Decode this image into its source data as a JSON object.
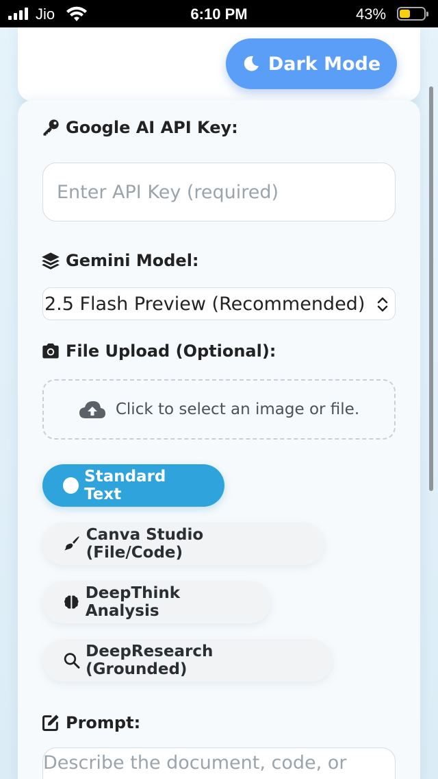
{
  "status_bar": {
    "carrier": "Jio",
    "time": "6:10 PM",
    "battery_percent": "43%",
    "battery_level": 0.43
  },
  "header": {
    "dark_mode_label": "Dark Mode"
  },
  "form": {
    "api_key_label": "Google AI API Key:",
    "api_key_placeholder": "Enter API Key (required)",
    "api_key_value": "",
    "model_label": "Gemini Model:",
    "model_selected": "2.5 Flash Preview (Recommended)",
    "upload_label": "File Upload (Optional):",
    "upload_hint": "Click to select an image or file.",
    "modes": [
      {
        "label": "Standard Text",
        "active": true
      },
      {
        "label": "Canva Studio (File/Code)",
        "active": false
      },
      {
        "label": "DeepThink Analysis",
        "active": false
      },
      {
        "label": "DeepResearch (Grounded)",
        "active": false
      }
    ],
    "prompt_label": "Prompt:",
    "prompt_placeholder": "Describe the document, code, or"
  },
  "icons": {
    "dark_mode": "moon-icon",
    "api_key": "key-icon",
    "model": "layers-icon",
    "upload": "camera-icon",
    "upload_zone": "cloud-upload-icon",
    "canva": "paintbrush-icon",
    "deepthink": "brain-icon",
    "deepresearch": "search-icon",
    "prompt": "edit-icon"
  },
  "colors": {
    "accent": "#5a9ef7",
    "active_mode": "#2fa3dc"
  }
}
